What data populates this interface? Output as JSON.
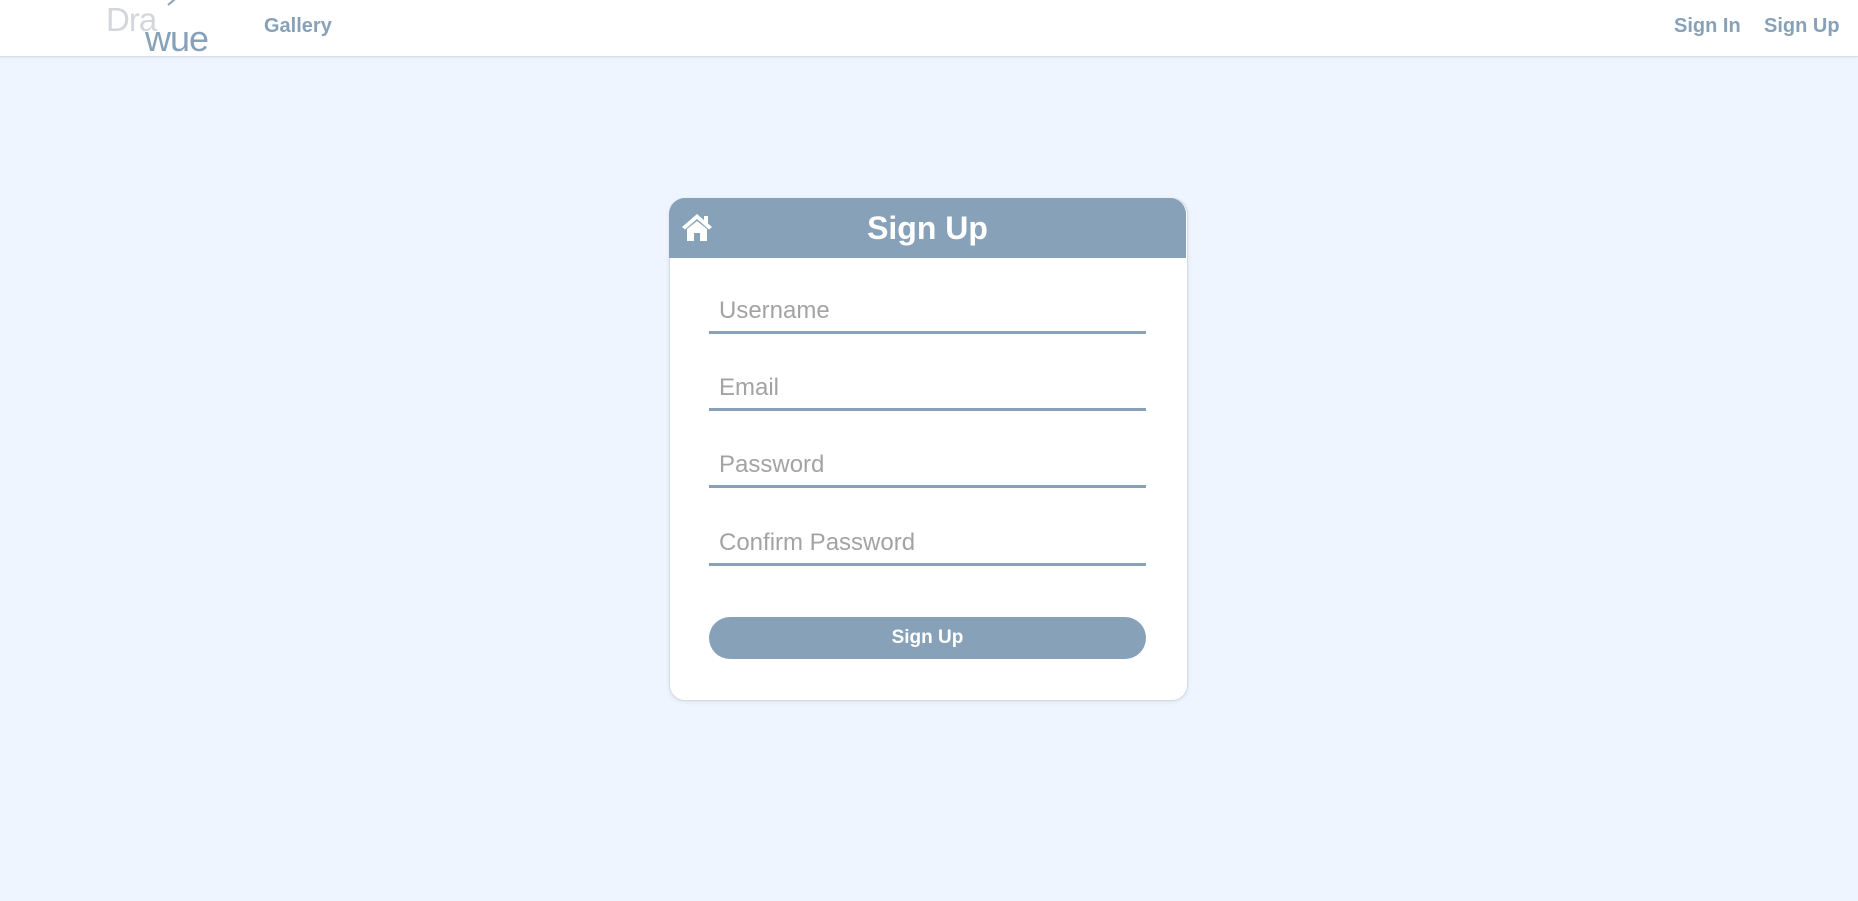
{
  "brand": {
    "logo_top": "Dra",
    "logo_bottom": "wue",
    "color_light": "#d3d7dc",
    "color_accent": "#87a1b8"
  },
  "nav": {
    "gallery_label": "Gallery",
    "sign_in_label": "Sign In",
    "sign_up_label": "Sign Up"
  },
  "form": {
    "home_icon": "home-icon",
    "title": "Sign Up",
    "username_placeholder": "Username",
    "email_placeholder": "Email",
    "password_placeholder": "Password",
    "confirm_password_placeholder": "Confirm Password",
    "submit_label": "Sign Up"
  },
  "colors": {
    "page_background": "#eef5fe",
    "accent": "#87a1b8",
    "card_background": "#ffffff"
  }
}
